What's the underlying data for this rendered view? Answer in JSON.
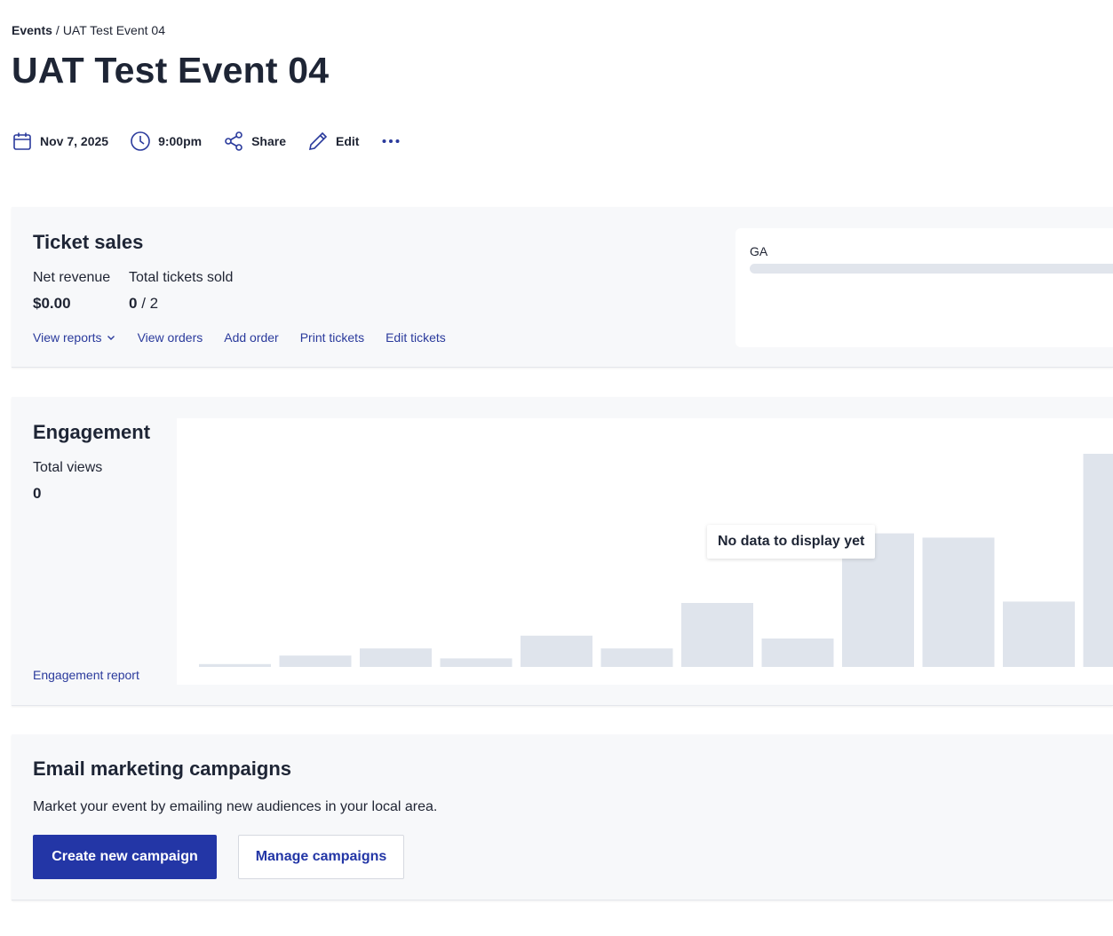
{
  "breadcrumb": {
    "parent": "Events",
    "separator": "/",
    "current": "UAT Test Event 04"
  },
  "page_title": "UAT Test Event 04",
  "meta": {
    "date": "Nov 7, 2025",
    "time": "9:00pm",
    "share_label": "Share",
    "edit_label": "Edit",
    "more_label": "•••"
  },
  "ticket_sales": {
    "title": "Ticket sales",
    "net_revenue_label": "Net revenue",
    "net_revenue_value": "$0.00",
    "tickets_sold_label": "Total tickets sold",
    "tickets_sold_value": "0",
    "tickets_total_value": "/ 2",
    "links": {
      "view_reports": "View reports",
      "view_orders": "View orders",
      "add_order": "Add order",
      "print_tickets": "Print tickets",
      "edit_tickets": "Edit tickets"
    },
    "tiers": [
      {
        "name": "GA",
        "sold_fraction": 0
      }
    ]
  },
  "engagement": {
    "title": "Engagement",
    "total_views_label": "Total views",
    "total_views_value": "0",
    "report_link": "Engagement report",
    "empty_message": "No data to display yet",
    "placeholder_bars": [
      2,
      8,
      13,
      6,
      22,
      13,
      45,
      20,
      94,
      91,
      46,
      150
    ]
  },
  "email_marketing": {
    "title": "Email marketing campaigns",
    "description": "Market your event by emailing new audiences in your local area.",
    "create_button": "Create new campaign",
    "manage_button": "Manage campaigns"
  },
  "colors": {
    "accent": "#2336a6",
    "link": "#2a3a9c",
    "placeholder_bar": "#dfe4ec",
    "card_bg": "#f7f8fa"
  },
  "icons": {
    "date": "calendar-icon",
    "time": "clock-icon",
    "share": "share-icon",
    "edit": "pencil-icon",
    "more": "more-dots-icon",
    "view_reports": "chevron-down-icon"
  }
}
